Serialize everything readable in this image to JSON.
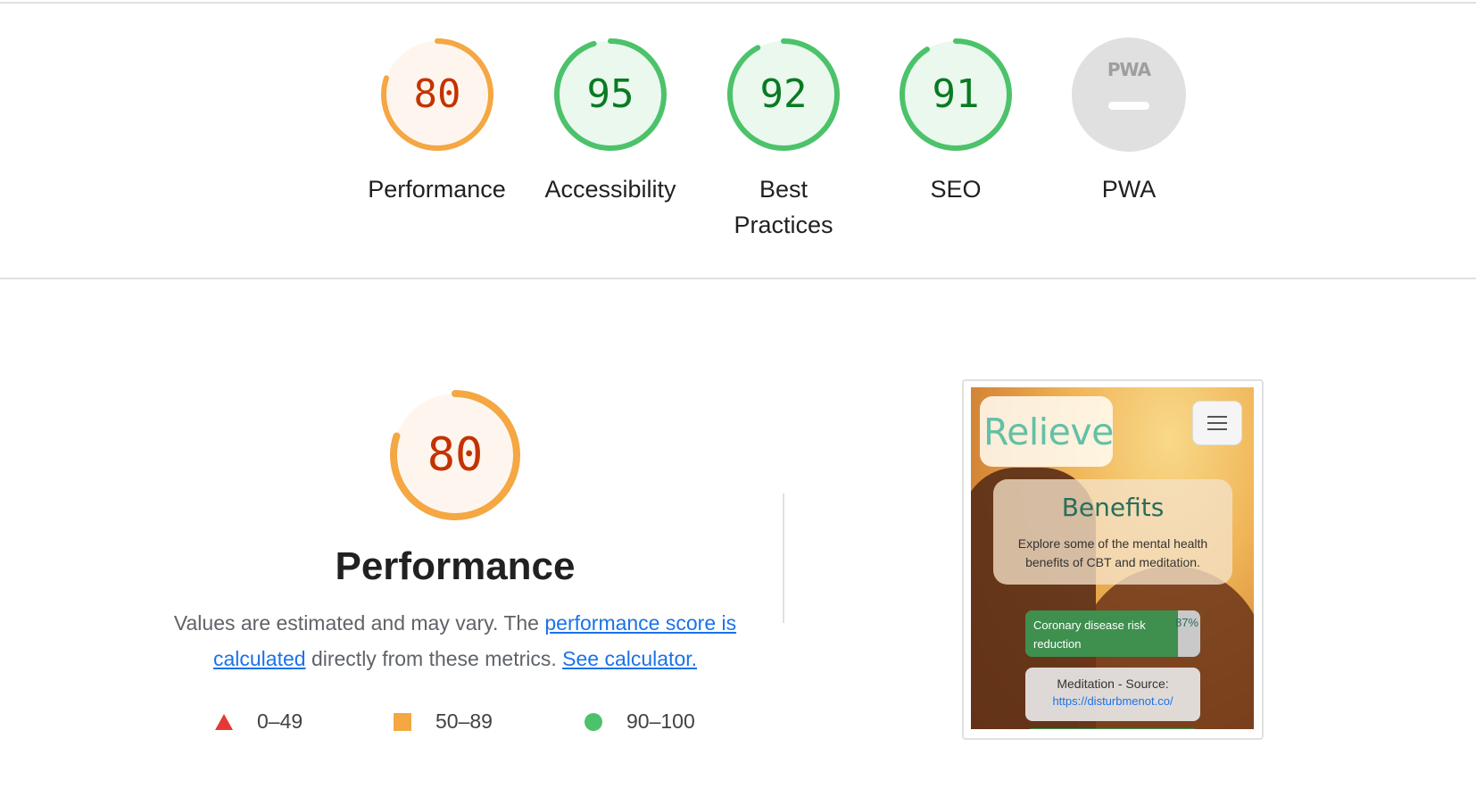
{
  "summary": {
    "categories": [
      {
        "label": "Performance",
        "score": 80,
        "rating": "average"
      },
      {
        "label": "Accessibility",
        "score": 95,
        "rating": "pass"
      },
      {
        "label": "Best Practices",
        "score": 92,
        "rating": "pass"
      },
      {
        "label": "SEO",
        "score": 91,
        "rating": "pass"
      },
      {
        "label": "PWA",
        "score": null,
        "rating": "not-applicable",
        "badge_text": "PWA"
      }
    ]
  },
  "performance": {
    "score": 80,
    "title": "Performance",
    "description_prefix": "Values are estimated and may vary. The ",
    "score_link_text": "performance score is calculated",
    "description_middle": " directly from these metrics. ",
    "calculator_link_text": "See calculator."
  },
  "legend": [
    {
      "shape": "triangle",
      "range": "0–49",
      "color": "#e53935"
    },
    {
      "shape": "square",
      "range": "50–89",
      "color": "#f4a742"
    },
    {
      "shape": "circle",
      "range": "90–100",
      "color": "#4cc26a"
    }
  ],
  "colors": {
    "average_stroke": "#f4a742",
    "average_fill": "#fef6ee",
    "average_text": "#c33300",
    "pass_stroke": "#4cc26a",
    "pass_fill": "#eaf8ee",
    "pass_text": "#0a7a22",
    "na_fill": "#e0e0e0",
    "na_text": "#9e9e9e"
  },
  "screenshot": {
    "logo": "Relieve",
    "benefits_title": "Benefits",
    "benefits_subtitle": "Explore some of the mental health benefits of CBT and meditation.",
    "bar_label": "Coronary disease risk reduction",
    "bar_value": "87%",
    "bar_fraction": 0.87,
    "source_label": "Meditation - Source:",
    "source_link": "https://disturbmenot.co/"
  }
}
